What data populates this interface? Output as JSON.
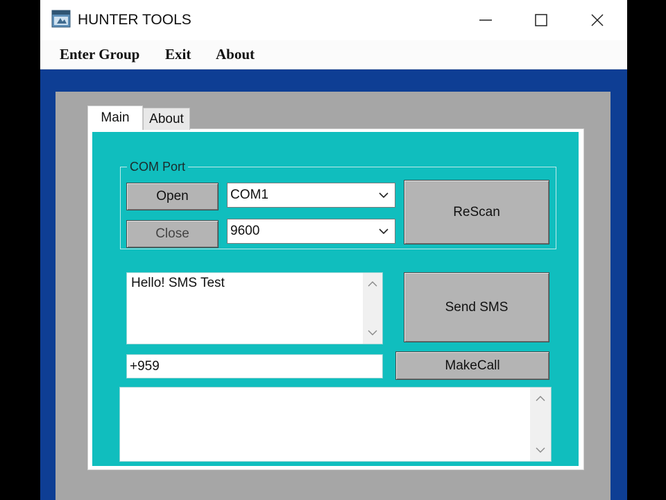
{
  "window": {
    "title": "HUNTER TOOLS",
    "icons": {
      "app": "app-window-icon",
      "minimize": "minimize-icon",
      "maximize": "maximize-icon",
      "close": "close-icon"
    }
  },
  "menu": {
    "items": [
      "Enter Group",
      "Exit",
      "About"
    ]
  },
  "tabs": {
    "items": [
      "Main",
      "About"
    ],
    "active": "Main"
  },
  "com_port": {
    "group_label": "COM Port",
    "open_label": "Open",
    "close_label": "Close",
    "port_value": "COM1",
    "baud_value": "9600",
    "rescan_label": "ReScan"
  },
  "sms": {
    "message": "Hello! SMS Test",
    "send_label": "Send SMS",
    "phone_value": "+959",
    "call_label": "MakeCall",
    "log_value": ""
  },
  "colors": {
    "panel": "#10bebe",
    "window_bg": "#0e3e94",
    "frame": "#a6a6a6",
    "button": "#b4b4b4"
  }
}
